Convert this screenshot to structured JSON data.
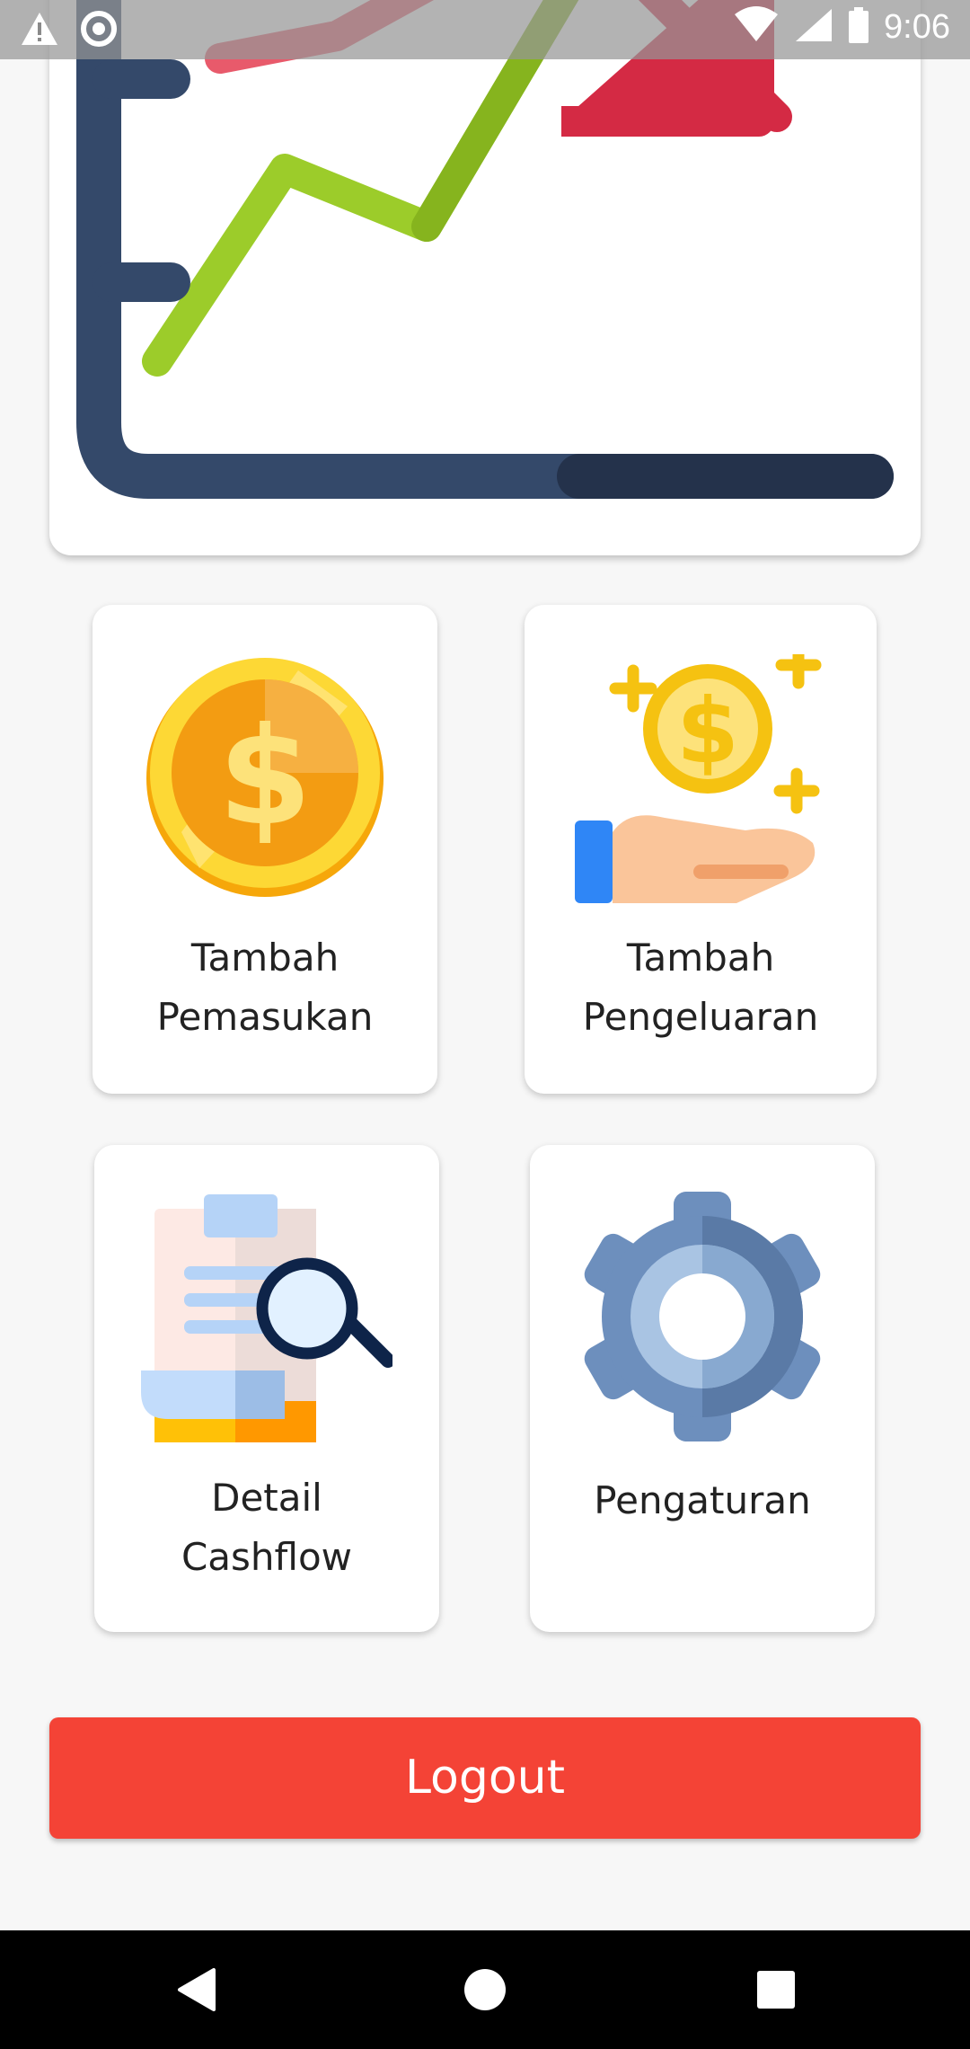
{
  "status_bar": {
    "time": "9:06",
    "left_icons": [
      "warning-icon",
      "sync-circle-icon"
    ],
    "right_icons": [
      "wifi-icon",
      "signal-icon",
      "battery-icon"
    ]
  },
  "hero": {
    "image": "chart-trend-illustration"
  },
  "menu": {
    "tiles": [
      {
        "id": "tambah-pemasukan",
        "line1": "Tambah",
        "line2": "Pemasukan",
        "icon": "coin-icon"
      },
      {
        "id": "tambah-pengeluaran",
        "line1": "Tambah",
        "line2": "Pengeluaran",
        "icon": "hand-coin-icon"
      },
      {
        "id": "detail-cashflow",
        "line1": "Detail",
        "line2": "Cashflow",
        "icon": "document-search-icon"
      },
      {
        "id": "pengaturan",
        "line1": "Pengaturan",
        "line2": "",
        "icon": "gear-icon"
      }
    ]
  },
  "logout": {
    "label": "Logout",
    "color": "#f44336"
  },
  "nav": {
    "buttons": [
      "back-icon",
      "home-icon",
      "recents-icon"
    ]
  }
}
